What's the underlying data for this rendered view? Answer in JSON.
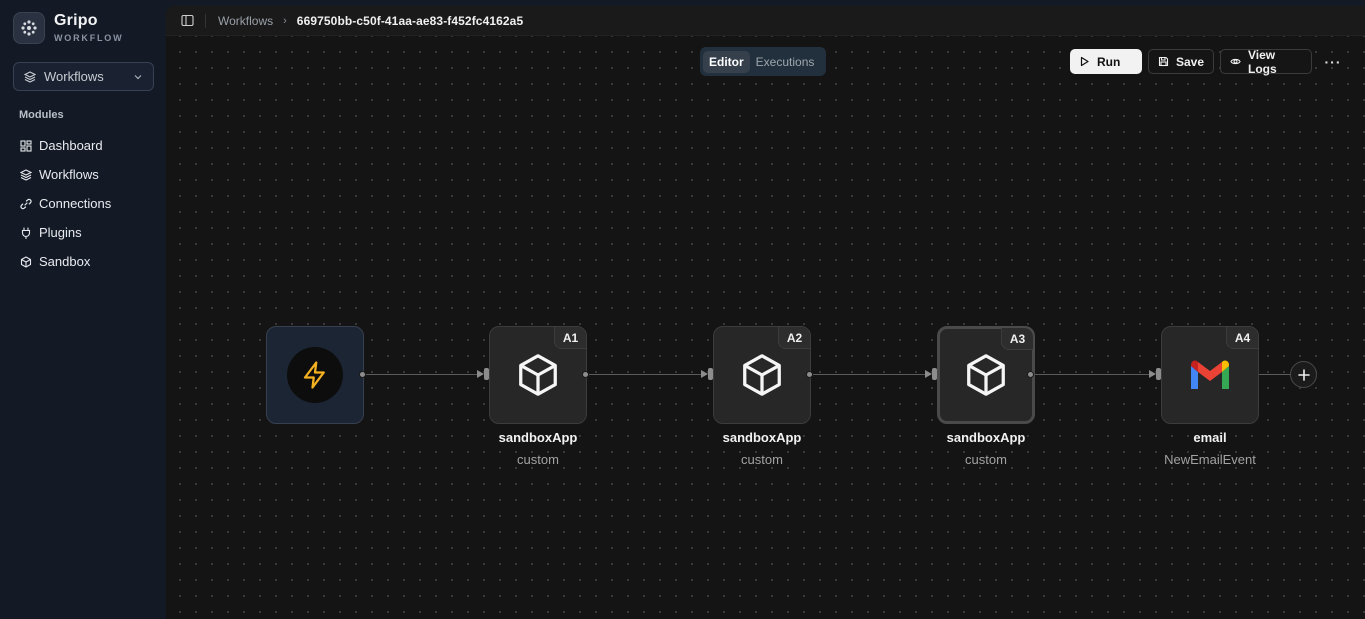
{
  "brand": {
    "name": "Gripo",
    "subtitle": "WORKFLOW",
    "logo_icon": "gear-grid-icon"
  },
  "sidebar": {
    "workspace_select": {
      "label": "Workflows",
      "icon": "layers-icon"
    },
    "section_title": "Modules",
    "items": [
      {
        "label": "Dashboard",
        "icon": "dashboard-icon"
      },
      {
        "label": "Workflows",
        "icon": "layers-icon"
      },
      {
        "label": "Connections",
        "icon": "link-icon"
      },
      {
        "label": "Plugins",
        "icon": "plug-icon"
      },
      {
        "label": "Sandbox",
        "icon": "cube-icon"
      }
    ]
  },
  "header": {
    "breadcrumb": {
      "parent": "Workflows",
      "current": "669750bb-c50f-41aa-ae83-f452fc4162a5"
    }
  },
  "mode_tabs": {
    "editor": "Editor",
    "executions": "Executions",
    "active": "Editor"
  },
  "actions": {
    "run": "Run",
    "save": "Save",
    "view_logs": "View Logs",
    "more": "···"
  },
  "flow": {
    "trigger": {
      "icon": "lightning-icon",
      "color": "#f5b120"
    },
    "nodes": [
      {
        "badge": "A1",
        "label": "sandboxApp",
        "sub": "custom",
        "icon": "cube-icon"
      },
      {
        "badge": "A2",
        "label": "sandboxApp",
        "sub": "custom",
        "icon": "cube-icon"
      },
      {
        "badge": "A3",
        "label": "sandboxApp",
        "sub": "custom",
        "icon": "cube-icon",
        "selected": true
      },
      {
        "badge": "A4",
        "label": "email",
        "sub": "NewEmailEvent",
        "icon": "gmail-icon"
      }
    ],
    "add_button": "+"
  }
}
